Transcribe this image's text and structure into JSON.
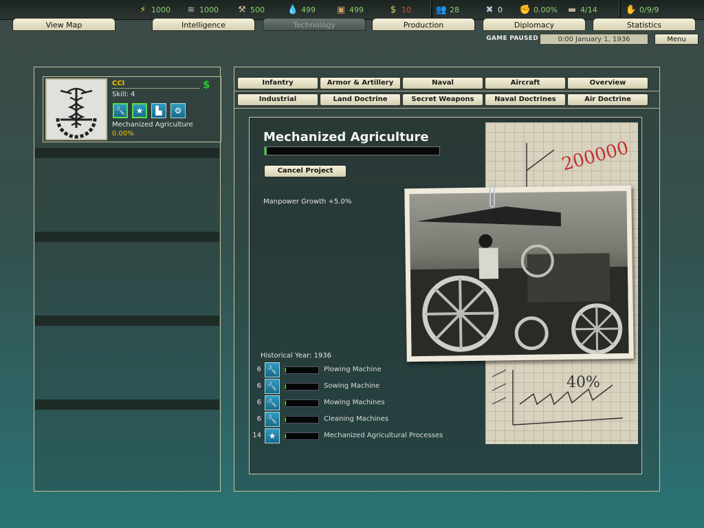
{
  "resources": [
    {
      "icon": "energy-icon",
      "value": "1000"
    },
    {
      "icon": "metal-icon",
      "value": "1000"
    },
    {
      "icon": "rare-materials-icon",
      "value": "500"
    },
    {
      "icon": "oil-icon",
      "value": "499"
    },
    {
      "icon": "supplies-icon",
      "value": "499"
    },
    {
      "icon": "money-icon",
      "value": "10"
    },
    {
      "icon": "manpower-icon",
      "value": "28"
    },
    {
      "icon": "transports-icon",
      "value": "0"
    },
    {
      "icon": "dissent-icon",
      "value": "0.00%"
    },
    {
      "icon": "convoys-icon",
      "value": "4/14"
    },
    {
      "icon": "leaders-icon",
      "value": "0/9/9"
    }
  ],
  "tabs": [
    "View Map",
    "Intelligence",
    "Technology",
    "Production",
    "Diplomacy",
    "Statistics"
  ],
  "active_tab": "Technology",
  "status": {
    "paused": "GAME PAUSED",
    "date": "0:00 January 1, 1936",
    "menu": "Menu"
  },
  "team": {
    "name": "CCI",
    "skill": "Skill: 4",
    "dollar": "$",
    "icons": [
      "wrench-icon",
      "star-icon",
      "factory-icon",
      "gears-icon"
    ],
    "project": "Mechanized Agriculture",
    "progress": "0.00%"
  },
  "categories_row1": [
    "Infantry",
    "Armor & Artillery",
    "Naval",
    "Aircraft",
    "Overview"
  ],
  "categories_row2": [
    "Industrial",
    "Land Doctrine",
    "Secret Weapons",
    "Naval Doctrines",
    "Air Doctrine"
  ],
  "tech": {
    "title": "Mechanized Agriculture",
    "progress_fraction": 0.01,
    "cancel": "Cancel Project",
    "effect": "Manpower Growth +5.0%",
    "historical_year": "Historical Year: 1936",
    "components": [
      {
        "difficulty": "6",
        "icon": "wrench-icon",
        "name": "Plowing Machine"
      },
      {
        "difficulty": "6",
        "icon": "wrench-icon",
        "name": "Sowing Machine"
      },
      {
        "difficulty": "6",
        "icon": "wrench-icon",
        "name": "Mowing Machines"
      },
      {
        "difficulty": "6",
        "icon": "wrench-icon",
        "name": "Cleaning Machines"
      },
      {
        "difficulty": "14",
        "icon": "star-icon",
        "name": "Mechanized Agricultural Processes"
      }
    ]
  }
}
